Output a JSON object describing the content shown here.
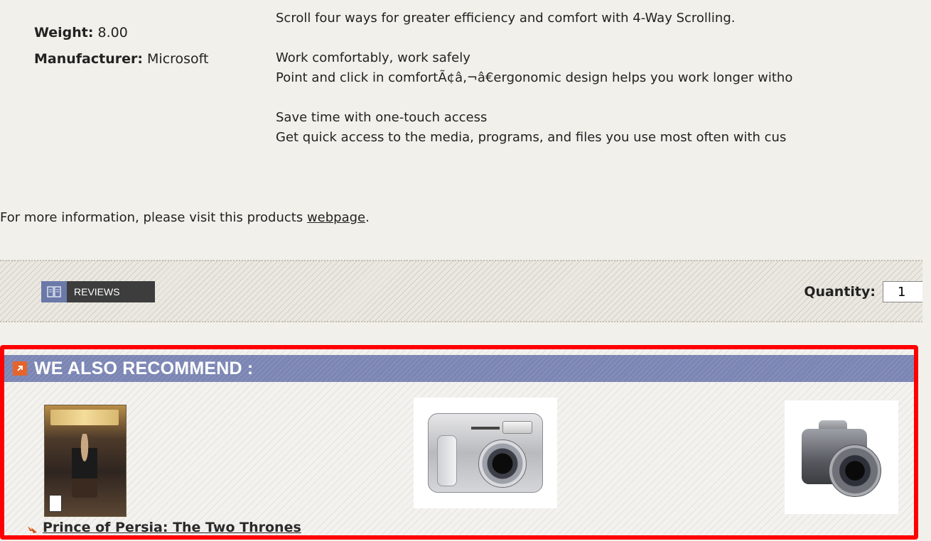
{
  "specs": {
    "weight_label": "Weight:",
    "weight_value": "8.00",
    "manufacturer_label": "Manufacturer:",
    "manufacturer_value": "Microsoft"
  },
  "description": {
    "lines": [
      "Scroll four ways for greater efficiency and comfort with 4-Way Scrolling.",
      "Work comfortably, work safely",
      "Point and click in comfortÃ¢â‚¬â€ergonomic design helps you work longer witho",
      "Save time with one-touch access",
      "Get quick access to the media, programs, and files you use most often with cus"
    ]
  },
  "more_info": {
    "prefix": "For more information, please visit this products ",
    "link_text": "webpage",
    "suffix": "."
  },
  "actions": {
    "reviews_label": "REVIEWS",
    "reviews_icon": "book-icon",
    "quantity_label": "Quantity:",
    "quantity_value": "1"
  },
  "recommend": {
    "title": "WE ALSO RECOMMEND :",
    "header_icon": "arrow-up-right-icon",
    "accent_color": "#e5642a",
    "header_color": "#7c86b4",
    "products": [
      {
        "name": "Prince of Persia: The Two Thrones",
        "image": "game-box-art"
      },
      {
        "name": "",
        "image": "olympus-camera"
      },
      {
        "name": "",
        "image": "bridge-camera"
      }
    ]
  }
}
